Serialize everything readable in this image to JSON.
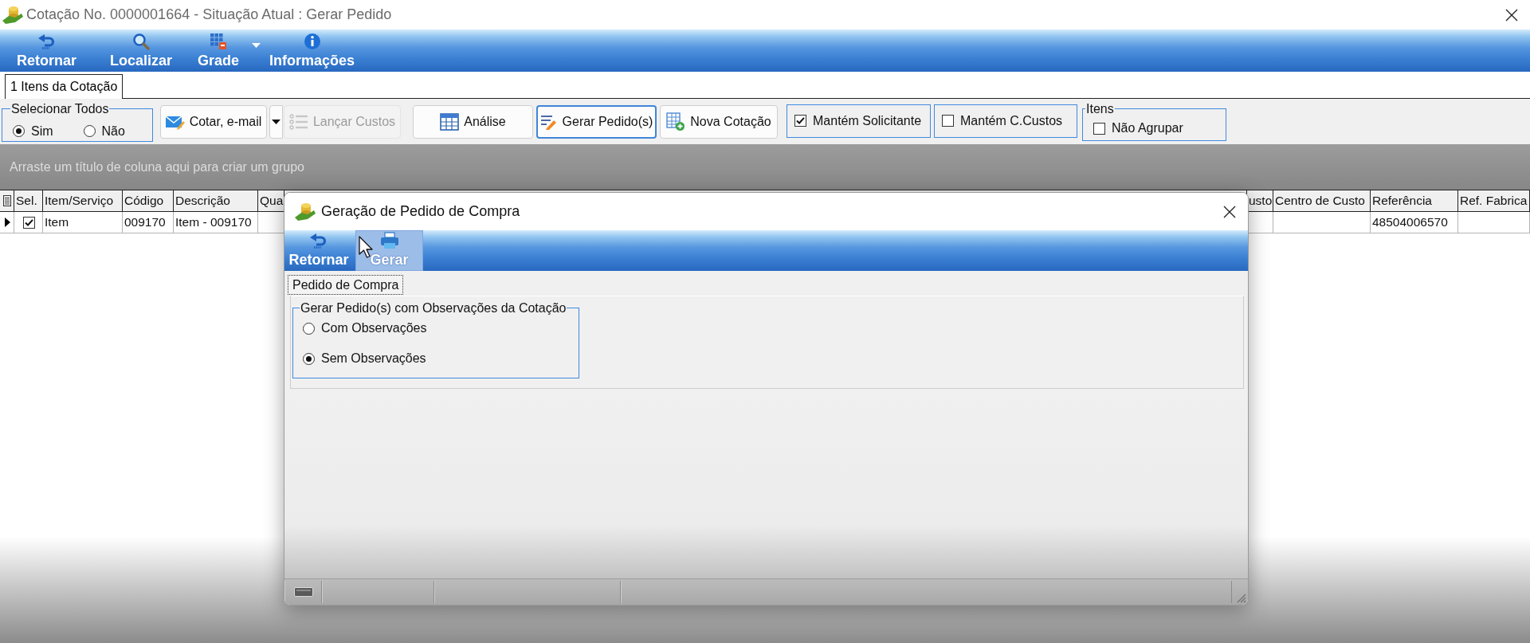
{
  "window": {
    "title": "Cotação No. 0000001664 - Situação Atual : Gerar Pedido"
  },
  "toolbar": [
    {
      "label": "Retornar",
      "has_menu": false
    },
    {
      "label": "Localizar",
      "has_menu": false
    },
    {
      "label": "Grade",
      "has_menu": true
    },
    {
      "label": "Informações",
      "has_menu": false
    }
  ],
  "tabs": [
    {
      "label": "1 Itens da Cotação",
      "selected": true
    }
  ],
  "actions": {
    "select_all": {
      "title": "Selecionar Todos",
      "options": [
        {
          "label": "Sim",
          "selected": true
        },
        {
          "label": "Não",
          "selected": false
        }
      ]
    },
    "buttons": [
      {
        "label": "Cotar, e-mail",
        "has_menu": true,
        "disabled": false,
        "focused": false
      },
      {
        "label": "Lançar Custos",
        "has_menu": false,
        "disabled": true,
        "focused": false
      },
      {
        "label": "Análise",
        "has_menu": false,
        "disabled": false,
        "focused": false
      },
      {
        "label": "Gerar Pedido(s)",
        "has_menu": false,
        "disabled": false,
        "focused": true
      },
      {
        "label": "Nova Cotação",
        "has_menu": false,
        "disabled": false,
        "focused": false
      }
    ],
    "options": [
      {
        "label": "Mantém Solicitante",
        "checked": true
      },
      {
        "label": "Mantém C.Custos",
        "checked": false
      }
    ],
    "items_group": {
      "title": "Itens",
      "options": [
        {
          "label": "Não Agrupar",
          "checked": false
        }
      ]
    }
  },
  "group_panel": {
    "hint": "Arraste um título de coluna aqui para criar um grupo"
  },
  "table": {
    "columns": [
      "Sel.",
      "Item/Serviço",
      "Código",
      "Descrição",
      "Qua",
      "usto",
      "Centro de Custo",
      "Referência",
      "Ref. Fabrica"
    ],
    "rows": [
      {
        "current": true,
        "checked": true,
        "cells": [
          "",
          "Item",
          "009170",
          "Item - 009170",
          "",
          "",
          "",
          "48504006570",
          ""
        ]
      }
    ]
  },
  "dialog": {
    "title": "Geração de Pedido de Compra",
    "toolbar": [
      {
        "label": "Retornar",
        "hovered": false
      },
      {
        "label": "Gerar",
        "hovered": true
      }
    ],
    "tabs": [
      {
        "label": "Pedido de Compra",
        "selected": true
      }
    ],
    "observations": {
      "title": "Gerar Pedido(s) com Observações da Cotação",
      "options": [
        {
          "label": "Com Observações",
          "selected": false
        },
        {
          "label": "Sem Observações",
          "selected": true
        }
      ]
    }
  }
}
